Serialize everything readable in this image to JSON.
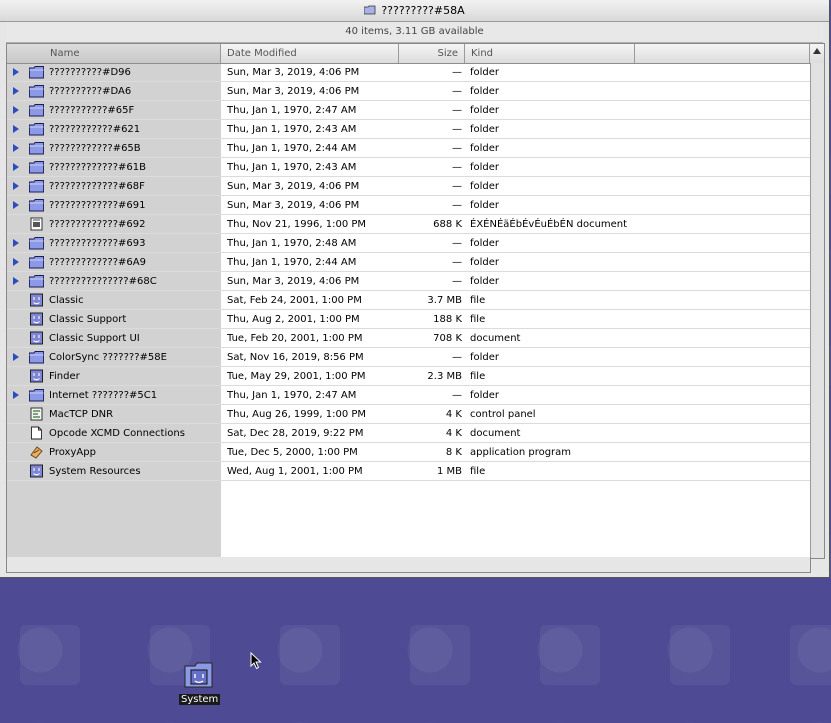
{
  "window": {
    "title": "?????????#58A",
    "info": "40 items, 3.11 GB available"
  },
  "columns": {
    "name": "Name",
    "date": "Date Modified",
    "size": "Size",
    "kind": "Kind"
  },
  "rows": [
    {
      "name": "??????????#D96",
      "date": "Sun, Mar 3, 2019, 4:06 PM",
      "size": "—",
      "kind": "folder",
      "icon": "folder-icon",
      "expandable": true
    },
    {
      "name": "??????????#DA6",
      "date": "Sun, Mar 3, 2019, 4:06 PM",
      "size": "—",
      "kind": "folder",
      "icon": "folder-icon",
      "expandable": true
    },
    {
      "name": "???????????#65F",
      "date": "Thu, Jan 1, 1970, 2:47 AM",
      "size": "—",
      "kind": "folder",
      "icon": "folder-icon",
      "expandable": true
    },
    {
      "name": "????????????#621",
      "date": "Thu, Jan 1, 1970, 2:43 AM",
      "size": "—",
      "kind": "folder",
      "icon": "folder-icon",
      "expandable": true
    },
    {
      "name": "????????????#65B",
      "date": "Thu, Jan 1, 1970, 2:44 AM",
      "size": "—",
      "kind": "folder",
      "icon": "folder-icon",
      "expandable": true
    },
    {
      "name": "?????????????#61B",
      "date": "Thu, Jan 1, 1970, 2:43 AM",
      "size": "—",
      "kind": "folder",
      "icon": "folder-icon",
      "expandable": true
    },
    {
      "name": "?????????????#68F",
      "date": "Sun, Mar 3, 2019, 4:06 PM",
      "size": "—",
      "kind": "folder",
      "icon": "folder-icon",
      "expandable": true
    },
    {
      "name": "?????????????#691",
      "date": "Sun, Mar 3, 2019, 4:06 PM",
      "size": "—",
      "kind": "folder",
      "icon": "folder-icon",
      "expandable": true
    },
    {
      "name": "?????????????#692",
      "date": "Thu, Nov 21, 1996, 1:00 PM",
      "size": "688 K",
      "kind": "ÉXÉNÉäÉbÉvÉuÉbÉN document",
      "icon": "document-icon",
      "expandable": false
    },
    {
      "name": "?????????????#693",
      "date": "Thu, Jan 1, 1970, 2:48 AM",
      "size": "—",
      "kind": "folder",
      "icon": "folder-icon",
      "expandable": true
    },
    {
      "name": "?????????????#6A9",
      "date": "Thu, Jan 1, 1970, 2:44 AM",
      "size": "—",
      "kind": "folder",
      "icon": "folder-icon",
      "expandable": true
    },
    {
      "name": "???????????????#68C",
      "date": "Sun, Mar 3, 2019, 4:06 PM",
      "size": "—",
      "kind": "folder",
      "icon": "folder-icon",
      "expandable": true
    },
    {
      "name": "Classic",
      "date": "Sat, Feb 24, 2001, 1:00 PM",
      "size": "3.7 MB",
      "kind": "file",
      "icon": "mac-file-icon",
      "expandable": false
    },
    {
      "name": "Classic Support",
      "date": "Thu, Aug 2, 2001, 1:00 PM",
      "size": "188 K",
      "kind": "file",
      "icon": "mac-file-icon",
      "expandable": false
    },
    {
      "name": "Classic Support UI",
      "date": "Tue, Feb 20, 2001, 1:00 PM",
      "size": "708 K",
      "kind": "document",
      "icon": "mac-file-icon",
      "expandable": false
    },
    {
      "name": "ColorSync ???????#58E",
      "date": "Sat, Nov 16, 2019, 8:56 PM",
      "size": "—",
      "kind": "folder",
      "icon": "folder-icon",
      "expandable": true
    },
    {
      "name": "Finder",
      "date": "Tue, May 29, 2001, 1:00 PM",
      "size": "2.3 MB",
      "kind": "file",
      "icon": "mac-file-icon",
      "expandable": false
    },
    {
      "name": "Internet ???????#5C1",
      "date": "Thu, Jan 1, 1970, 2:47 AM",
      "size": "—",
      "kind": "folder",
      "icon": "folder-icon",
      "expandable": true
    },
    {
      "name": "MacTCP DNR",
      "date": "Thu, Aug 26, 1999, 1:00 PM",
      "size": "4 K",
      "kind": "control panel",
      "icon": "control-panel-icon",
      "expandable": false
    },
    {
      "name": "Opcode XCMD Connections",
      "date": "Sat, Dec 28, 2019, 9:22 PM",
      "size": "4 K",
      "kind": "document",
      "icon": "blank-document-icon",
      "expandable": false
    },
    {
      "name": "ProxyApp",
      "date": "Tue, Dec 5, 2000, 1:00 PM",
      "size": "8 K",
      "kind": "application program",
      "icon": "application-icon",
      "expandable": false
    },
    {
      "name": "System Resources",
      "date": "Wed, Aug 1, 2001, 1:00 PM",
      "size": "1 MB",
      "kind": "file",
      "icon": "mac-file-icon",
      "expandable": false
    }
  ],
  "desktop": {
    "system_icon_label": "System"
  },
  "colors": {
    "desktop": "#4e4a94",
    "name_column": "#d2d2d2",
    "triangle": "#2d4dbb",
    "folder": "#8c99e6"
  }
}
